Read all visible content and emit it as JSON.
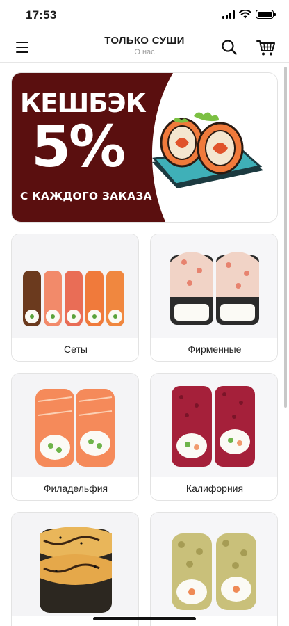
{
  "status_bar": {
    "time": "17:53"
  },
  "header": {
    "title": "ТОЛЬКО СУШИ",
    "subtitle": "О нас"
  },
  "icons": {
    "menu": "hamburger-menu-icon",
    "search": "search-icon",
    "cart": "shopping-cart-icon"
  },
  "banner": {
    "title": "КЕШБЭК",
    "percent": "5%",
    "subtitle": "С КАЖДОГО ЗАКАЗА",
    "colors": {
      "background": "#5a0f0f",
      "accent_roll": "#f07a3b",
      "plate": "#3fb0b8"
    }
  },
  "categories": [
    {
      "label": "Сеты"
    },
    {
      "label": "Фирменные"
    },
    {
      "label": "Филадельфия"
    },
    {
      "label": "Калифорния"
    },
    {
      "label": ""
    },
    {
      "label": ""
    }
  ]
}
